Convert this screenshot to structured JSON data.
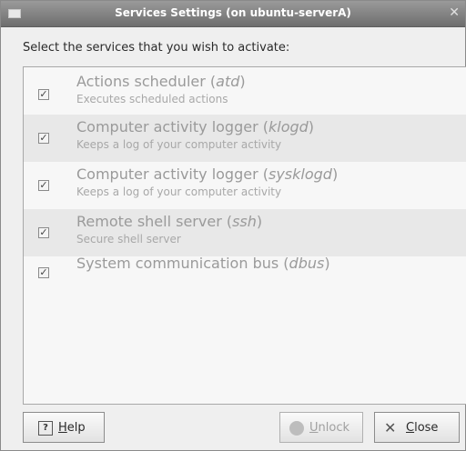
{
  "window": {
    "title": "Services Settings (on ubuntu-serverA)"
  },
  "prompt": "Select the services that you wish to activate:",
  "services": [
    {
      "name": "Actions scheduler",
      "daemon": "atd",
      "description": "Executes scheduled actions",
      "checked": true
    },
    {
      "name": "Computer activity logger",
      "daemon": "klogd",
      "description": "Keeps a log of your computer activity",
      "checked": true
    },
    {
      "name": "Computer activity logger",
      "daemon": "sysklogd",
      "description": "Keeps a log of your computer activity",
      "checked": true
    },
    {
      "name": "Remote shell server",
      "daemon": "ssh",
      "description": "Secure shell server",
      "checked": true
    },
    {
      "name": "System communication bus",
      "daemon": "dbus",
      "description": "",
      "checked": true
    }
  ],
  "buttons": {
    "help": {
      "mnemonic": "H",
      "rest": "elp"
    },
    "unlock": {
      "mnemonic": "U",
      "rest": "nlock"
    },
    "close": {
      "mnemonic": "C",
      "rest": "lose"
    }
  },
  "icons": {
    "menu": "window-menu-icon",
    "close": "close-icon",
    "help": "help-icon",
    "unlock": "lock-icon",
    "close_button": "close-x-icon"
  }
}
